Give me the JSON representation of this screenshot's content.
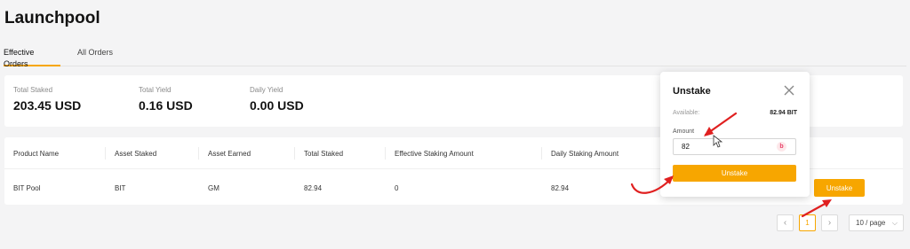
{
  "page": {
    "title": "Launchpool"
  },
  "tabs": [
    {
      "label": "Effective Orders",
      "active": true
    },
    {
      "label": "All Orders",
      "active": false
    }
  ],
  "stats": [
    {
      "label": "Total Staked",
      "value": "203.45 USD"
    },
    {
      "label": "Total Yield",
      "value": "0.16 USD"
    },
    {
      "label": "Daily Yield",
      "value": "0.00 USD"
    }
  ],
  "table": {
    "columns": [
      "Product Name",
      "Asset Staked",
      "Asset Earned",
      "Total Staked",
      "Effective Staking Amount",
      "Daily Staking Amount"
    ],
    "rows": [
      {
        "product": "BIT Pool",
        "asset_staked": "BIT",
        "asset_earned": "GM",
        "total_staked": "82.94",
        "effective": "0",
        "daily": "82.94",
        "action": "Unstake"
      }
    ]
  },
  "pagination": {
    "current_page": "1",
    "page_size": "10 / page"
  },
  "modal": {
    "title": "Unstake",
    "available_label": "Available:",
    "available_value": "82.94 BIT",
    "amount_label": "Amount",
    "amount_value": "82",
    "input_icon": "b",
    "submit_label": "Unstake"
  },
  "colors": {
    "accent": "#f7a600",
    "annotation": "#e02020"
  }
}
